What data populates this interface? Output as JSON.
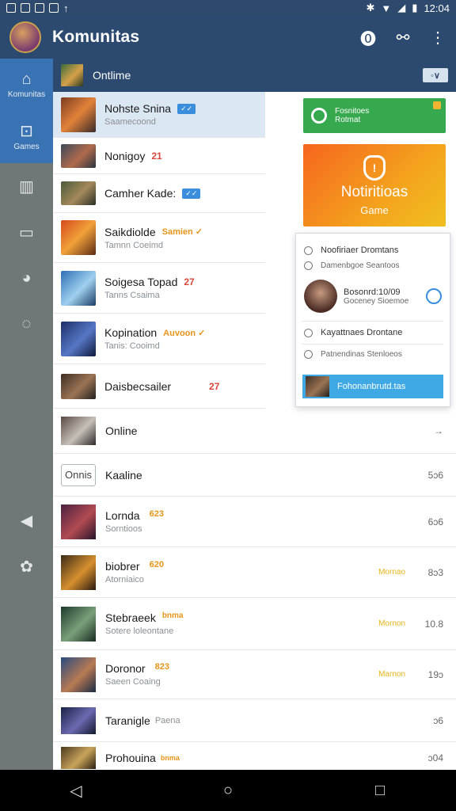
{
  "status_bar": {
    "time": "12:04"
  },
  "app_bar": {
    "title": "Komunitas",
    "actions": [
      "info-icon",
      "share-icon",
      "more-vert-icon"
    ]
  },
  "rail": {
    "items": [
      {
        "label": "Komunitas",
        "icon": "home-icon",
        "active": true
      },
      {
        "label": "Games",
        "icon": "gamepad-icon",
        "active": true
      },
      {
        "label": "",
        "icon": "book-icon"
      },
      {
        "label": "",
        "icon": "tv-icon"
      },
      {
        "label": "",
        "icon": "chat-icon"
      },
      {
        "label": "",
        "icon": "stats-icon"
      },
      {
        "label": "",
        "icon": "megaphone-icon"
      },
      {
        "label": "",
        "icon": "settings-icon"
      }
    ]
  },
  "section_header": {
    "title": "Ontlime",
    "dropdown": "◦∨"
  },
  "top_list": [
    {
      "title": "Nohste Snina",
      "subtitle": "Saamecoond",
      "tag": "✓✓",
      "tag_type": "blue"
    },
    {
      "title": "Nonigoy",
      "subtitle": "",
      "tag": "21",
      "tag_type": "red"
    },
    {
      "title": "Camher Kade:",
      "subtitle": "",
      "tag": "✓✓",
      "tag_type": "blue"
    },
    {
      "title": "Saikdiolde",
      "subtitle": "Tamnn Coeimd",
      "tag": "Samien ✓",
      "tag_type": "orange"
    },
    {
      "title": "Soigesa Topad",
      "subtitle": "Tanns Csaima",
      "tag": "27",
      "tag_type": "red"
    },
    {
      "title": "Kopination",
      "subtitle": "Tanis: Cooimd",
      "tag": "Auvoon ✓",
      "tag_type": "orange"
    },
    {
      "title": "Daisbecsailer",
      "subtitle": "",
      "tag": "27",
      "tag_type": "red"
    }
  ],
  "ad_green": {
    "line1": "Fosnitoes",
    "line2": "Rotmat"
  },
  "ad_orange": {
    "title": "Notiritioas",
    "subtitle": "Game"
  },
  "popup": {
    "row1_title": "Noofiriaer Dromtans",
    "row1_sub": "Damenbgoe Seantoos",
    "profile_name": "Bosonrd:10/09",
    "profile_sub": "Goceney Sioemoe",
    "row3_title": "Kayattnaes Drontane",
    "row4_title": "Patnendinas Stenloeos",
    "button_label": "Fohonanbrutd.tas"
  },
  "bottom_list": [
    {
      "title": "Online",
      "subtitle": "",
      "tag": "",
      "mid": "",
      "value": "→"
    },
    {
      "title": "Kaaline",
      "subtitle": "",
      "tag": "",
      "mid": "",
      "value": "5ɔ6",
      "outline": "Onnis"
    },
    {
      "title": "Lornda",
      "subtitle": "Sorntioos",
      "tag": "623",
      "mid": "",
      "value": "6ɔ6"
    },
    {
      "title": "biobrer",
      "subtitle": "Atorniaico",
      "tag": "620",
      "mid": "Mornao",
      "value": "8ɔ3"
    },
    {
      "title": "Stebraeek",
      "subtitle": "Sotere loleontane",
      "tag": "bnma",
      "mid": "Mornon",
      "value": "10.8"
    },
    {
      "title": "Doronor",
      "subtitle": "Saeen Coaing",
      "tag": "823",
      "mid": "Marnon",
      "value": "19ɔ"
    },
    {
      "title": "Taranigle",
      "subtitle": "",
      "tag": "Paena",
      "mid": "",
      "value": "ɔ6"
    },
    {
      "title": "Prohouina",
      "subtitle": "",
      "tag": "bnma",
      "mid": "",
      "value": "ɔ04"
    }
  ]
}
